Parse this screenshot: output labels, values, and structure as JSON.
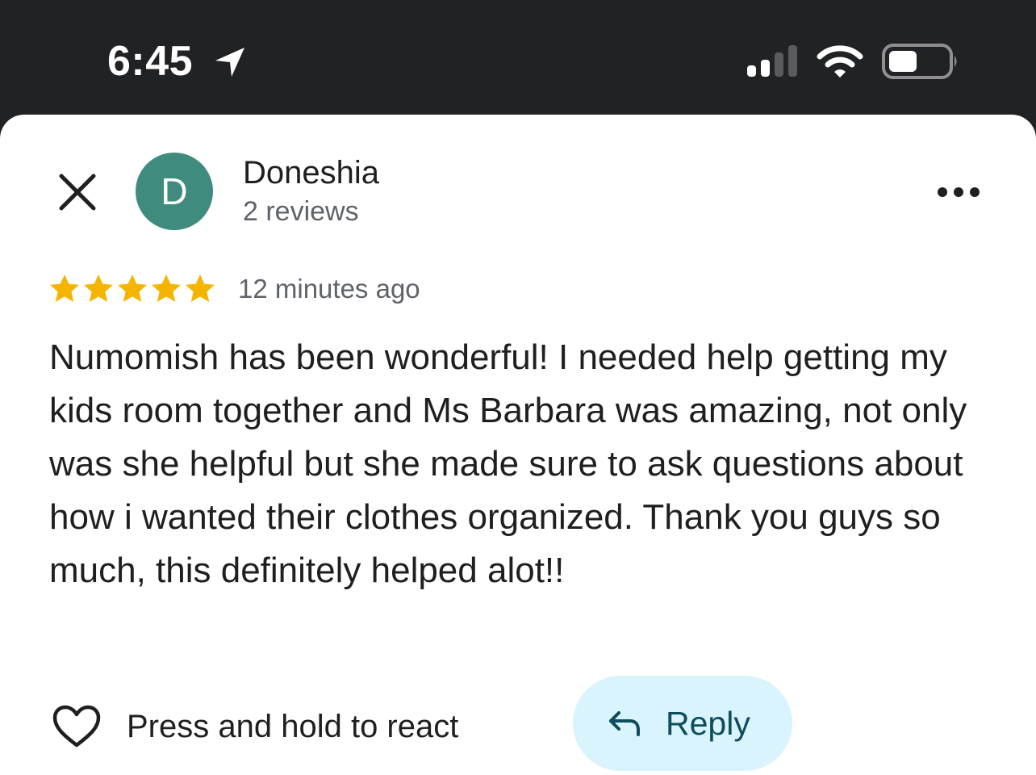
{
  "status_bar": {
    "time": "6:45",
    "location_icon": "location-arrow-icon",
    "signal_icon": "cellular-signal-icon",
    "wifi_icon": "wifi-icon",
    "battery_icon": "battery-icon"
  },
  "review": {
    "close_icon": "close-icon",
    "avatar_initial": "D",
    "avatar_color": "#3f8b7e",
    "reviewer_name": "Doneshia",
    "review_count": "2 reviews",
    "more_icon": "more-options-icon",
    "rating": 5,
    "rating_max": 5,
    "star_color": "#f4b400",
    "timestamp": "12 minutes ago",
    "text": "Numomish has been wonderful! I needed help getting my kids room together and Ms Barbara was amazing, not only was she helpful but she made sure to ask questions about how i wanted their clothes organized. Thank you guys so much, this definitely helped alot!!"
  },
  "actions": {
    "react_icon": "heart-outline-icon",
    "react_label": "Press and hold to react",
    "reply_icon": "reply-arrow-icon",
    "reply_label": "Reply",
    "reply_bg_color": "#d9f4fc"
  }
}
